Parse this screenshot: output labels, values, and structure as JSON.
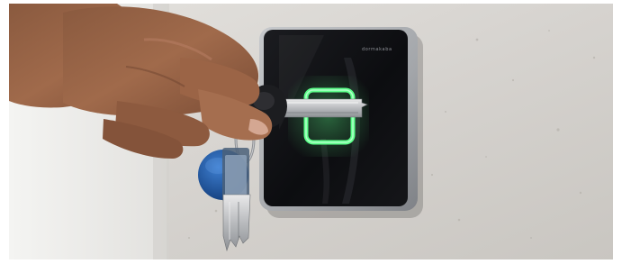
{
  "photo": {
    "reader": {
      "brand_text": "dormakaba",
      "indicator_color": "#5dff8a",
      "panel_color": "#0e0f12",
      "frame_color": "#9c9fa4"
    },
    "key_fob": {
      "color": "#1f5fb4",
      "label_top": "",
      "label_bottom": ""
    }
  }
}
